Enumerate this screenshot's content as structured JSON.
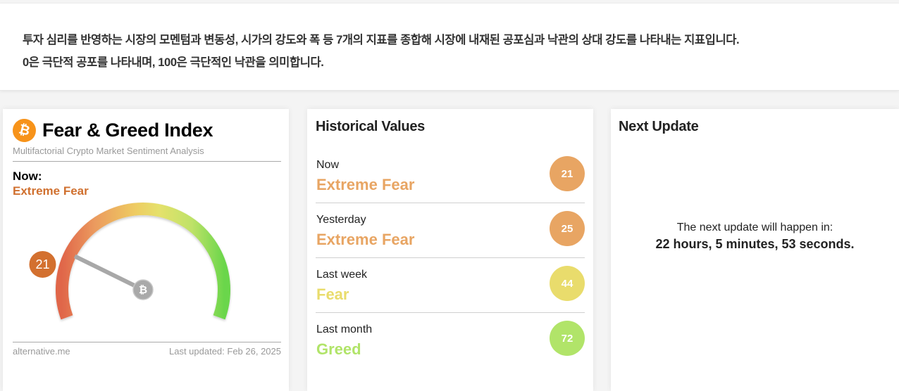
{
  "intro": {
    "line1": "투자 심리를 반영하는 시장의 모멘텀과 변동성, 시가의 강도와 폭 등 7개의 지표를 종합해 시장에 내재된 공포심과 낙관의 상대 강도를 나타내는 지표입니다.",
    "line2": "0은 극단적 공포를 나타내며, 100은 극단적인 낙관을 의미합니다."
  },
  "fng": {
    "logo_glyph": "₿",
    "title": "Fear & Greed Index",
    "subtitle": "Multifactorial Crypto Market Sentiment Analysis",
    "now_label": "Now:",
    "now_classification": "Extreme Fear",
    "value": 21,
    "value_label": "21",
    "gauge_min": 0,
    "gauge_max": 100,
    "source": "alternative.me",
    "last_updated": "Last updated: Feb 26, 2025",
    "colors": {
      "badge": "#d3702f",
      "classification": "#d0702f"
    }
  },
  "historical": {
    "title": "Historical Values",
    "rows": [
      {
        "period": "Now",
        "classification": "Extreme Fear",
        "value": "21",
        "color": "#e8a563"
      },
      {
        "period": "Yesterday",
        "classification": "Extreme Fear",
        "value": "25",
        "color": "#e8a563"
      },
      {
        "period": "Last week",
        "classification": "Fear",
        "value": "44",
        "color": "#e9dc6c"
      },
      {
        "period": "Last month",
        "classification": "Greed",
        "value": "72",
        "color": "#b1e469"
      }
    ]
  },
  "next_update": {
    "title": "Next Update",
    "line1": "The next update will happen in:",
    "countdown": "22 hours, 5 minutes, 53 seconds."
  }
}
